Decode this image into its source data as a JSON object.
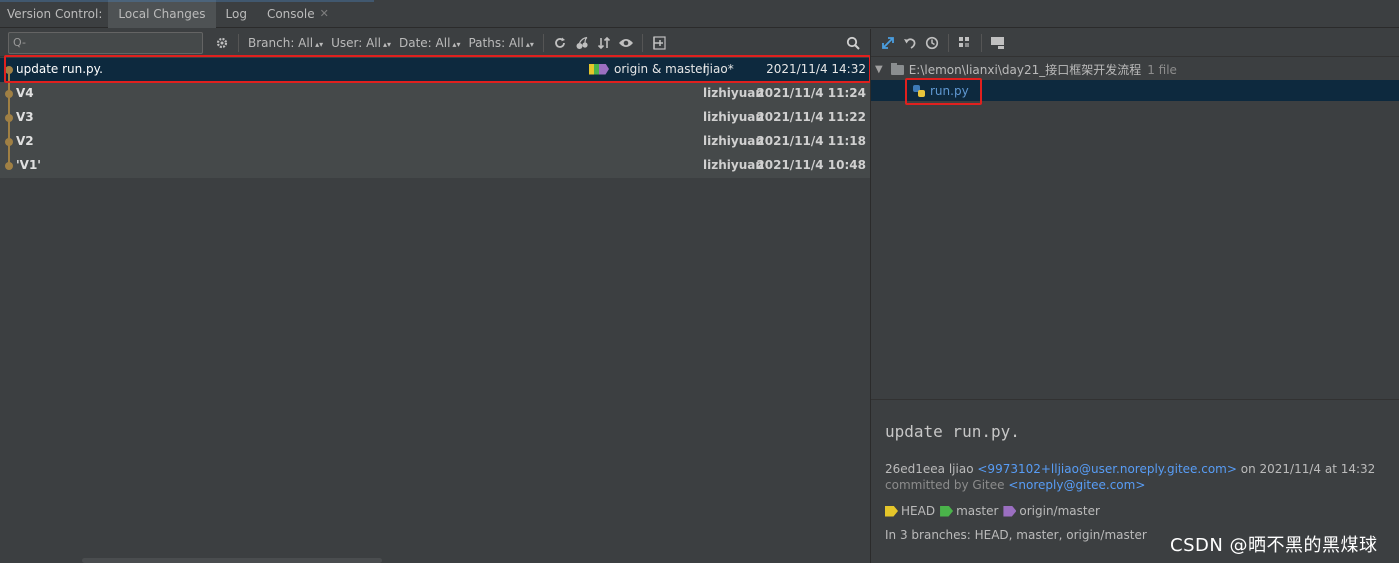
{
  "tabbar": {
    "label": "Version Control:",
    "tabs": [
      {
        "label": "Local Changes"
      },
      {
        "label": "Log"
      },
      {
        "label": "Console"
      }
    ]
  },
  "toolbar": {
    "search_placeholder": "Q-",
    "filters": [
      {
        "label": "Branch: All"
      },
      {
        "label": "User: All"
      },
      {
        "label": "Date: All"
      },
      {
        "label": "Paths: All"
      }
    ]
  },
  "commits": [
    {
      "subject": "update run.py.",
      "refs": "origin & master",
      "author": "ljiao*",
      "date": "2021/11/4 14:32"
    },
    {
      "subject": "V4",
      "refs": "",
      "author": "lizhiyuan",
      "date": "2021/11/4 11:24"
    },
    {
      "subject": "V3",
      "refs": "",
      "author": "lizhiyuan",
      "date": "2021/11/4 11:22"
    },
    {
      "subject": "V2",
      "refs": "",
      "author": "lizhiyuan",
      "date": "2021/11/4 11:18"
    },
    {
      "subject": "'V1'",
      "refs": "",
      "author": "lizhiyuan",
      "date": "2021/11/4 10:48"
    }
  ],
  "changes_tree": {
    "folder_path": "E:\\lemon\\lianxi\\day21_接口框架开发流程",
    "file_count": "1 file",
    "files": [
      {
        "name": "run.py"
      }
    ]
  },
  "details": {
    "subject": "update run.py.",
    "hash_author": "26ed1eea ljiao",
    "email": "<9973102+lljiao@user.noreply.gitee.com>",
    "on_date": "on 2021/11/4 at 14:32",
    "committed_by": "committed by Gitee",
    "committer_email": "<noreply@gitee.com>",
    "badges": [
      {
        "label": "HEAD",
        "color": "#e5c62a"
      },
      {
        "label": "master",
        "color": "#4ab34a"
      },
      {
        "label": "origin/master",
        "color": "#9b6fc1"
      }
    ],
    "branches": "In 3 branches: HEAD, master, origin/master"
  },
  "watermark": "CSDN @晒不黑的黑煤球",
  "colors": {
    "background": "#3c3f41",
    "selection": "#0d293e",
    "highlight_box": "#e0201e",
    "graph": "#a08044",
    "link": "#589df6"
  }
}
